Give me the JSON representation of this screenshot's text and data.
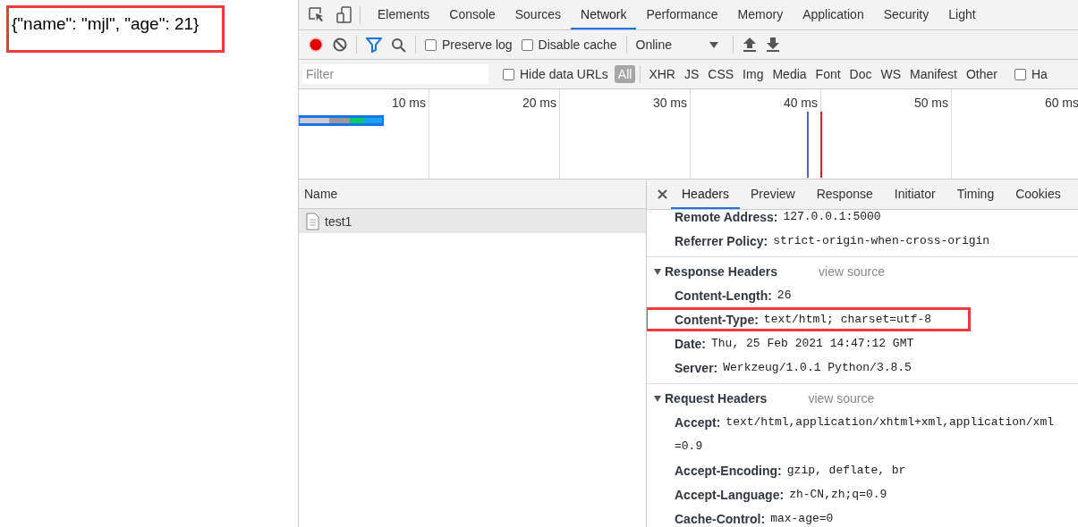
{
  "page": {
    "body_text": "{\"name\": \"mjl\", \"age\": 21}",
    "highlighted": true
  },
  "devtools": {
    "tabs": [
      {
        "label": "Elements",
        "selected": false
      },
      {
        "label": "Console",
        "selected": false
      },
      {
        "label": "Sources",
        "selected": false
      },
      {
        "label": "Network",
        "selected": true
      },
      {
        "label": "Performance",
        "selected": false
      },
      {
        "label": "Memory",
        "selected": false
      },
      {
        "label": "Application",
        "selected": false
      },
      {
        "label": "Security",
        "selected": false
      },
      {
        "label": "Light",
        "selected": false
      }
    ],
    "toolbar": {
      "recording": true,
      "preserve_log": {
        "label": "Preserve log",
        "checked": false
      },
      "disable_cache": {
        "label": "Disable cache",
        "checked": false
      },
      "throttling": "Online"
    },
    "filter": {
      "placeholder": "Filter",
      "hide_data_urls": {
        "label": "Hide data URLs",
        "checked": false
      },
      "types": [
        {
          "label": "All",
          "selected": true
        },
        {
          "label": "XHR",
          "selected": false
        },
        {
          "label": "JS",
          "selected": false
        },
        {
          "label": "CSS",
          "selected": false
        },
        {
          "label": "Img",
          "selected": false
        },
        {
          "label": "Media",
          "selected": false
        },
        {
          "label": "Font",
          "selected": false
        },
        {
          "label": "Doc",
          "selected": false
        },
        {
          "label": "WS",
          "selected": false
        },
        {
          "label": "Manifest",
          "selected": false
        },
        {
          "label": "Other",
          "selected": false
        }
      ],
      "trailing_checkbox": {
        "label": "Ha",
        "checked": false
      }
    },
    "timeline": {
      "ticks": [
        "10 ms",
        "20 ms",
        "30 ms",
        "40 ms",
        "50 ms",
        "60 ms"
      ]
    },
    "requests": {
      "column": "Name",
      "rows": [
        {
          "name": "test1",
          "selected": true
        }
      ]
    },
    "detail_tabs": [
      {
        "label": "Headers",
        "selected": true
      },
      {
        "label": "Preview",
        "selected": false
      },
      {
        "label": "Response",
        "selected": false
      },
      {
        "label": "Initiator",
        "selected": false
      },
      {
        "label": "Timing",
        "selected": false
      },
      {
        "label": "Cookies",
        "selected": false
      }
    ],
    "general": [
      {
        "name": "Remote Address:",
        "value": "127.0.0.1:5000"
      },
      {
        "name": "Referrer Policy:",
        "value": "strict-origin-when-cross-origin"
      }
    ],
    "sections": [
      {
        "title": "Response Headers",
        "expanded": true,
        "link": "view source",
        "headers": [
          {
            "name": "Content-Length:",
            "value": "26",
            "highlighted": false
          },
          {
            "name": "Content-Type:",
            "value": "text/html; charset=utf-8",
            "highlighted": true
          },
          {
            "name": "Date:",
            "value": "Thu, 25 Feb 2021 14:47:12 GMT",
            "highlighted": false
          },
          {
            "name": "Server:",
            "value": "Werkzeug/1.0.1 Python/3.8.5",
            "highlighted": false
          }
        ]
      },
      {
        "title": "Request Headers",
        "expanded": true,
        "link": "view source",
        "headers": [
          {
            "name": "Accept:",
            "value": "text/html,application/xhtml+xml,application/xml",
            "continuation": "=0.9",
            "highlighted": false
          },
          {
            "name": "Accept-Encoding:",
            "value": "gzip, deflate, br",
            "highlighted": false
          },
          {
            "name": "Accept-Language:",
            "value": "zh-CN,zh;q=0.9",
            "highlighted": false
          },
          {
            "name": "Cache-Control:",
            "value": "max-age=0",
            "highlighted": false
          }
        ]
      }
    ]
  }
}
